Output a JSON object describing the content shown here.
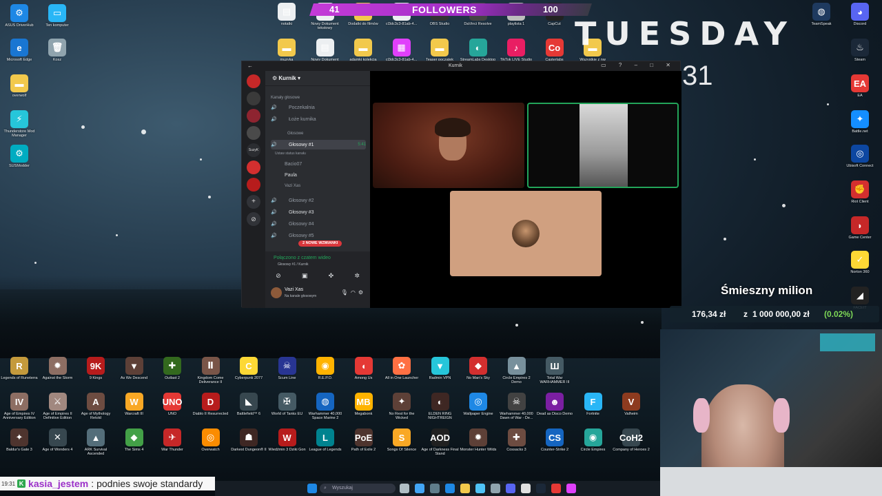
{
  "desktop_top_left": [
    {
      "label": "ASUS DriverHub",
      "color": "#1e88e5",
      "glyph": "⚙"
    },
    {
      "label": "Ten komputer",
      "color": "#29b6f6",
      "glyph": "▭"
    },
    {
      "label": "Microsoft Edge",
      "color": "#1976d2",
      "glyph": "e"
    },
    {
      "label": "Kosz",
      "color": "#90a4ae",
      "glyph": "🗑"
    },
    {
      "label": "overwolf",
      "color": "#f2c94c",
      "glyph": "▬"
    },
    {
      "label": "Thunderstore Mod Manager",
      "color": "#26c6da",
      "glyph": "⚡"
    },
    {
      "label": "SUSModder",
      "color": "#00acc1",
      "glyph": "⚙"
    }
  ],
  "desktop_top_row": [
    {
      "label": "notatki",
      "color": "#eceff1",
      "glyph": "▤"
    },
    {
      "label": "Nowy Dokument tekstowy",
      "color": "#eceff1",
      "glyph": "▤"
    },
    {
      "label": "Dodatki do filmów",
      "color": "#f2c94c",
      "glyph": "▬"
    },
    {
      "label": "cl3dc3c3-81ab-4...",
      "color": "#eceff1",
      "glyph": "▤"
    },
    {
      "label": "OBS Studio",
      "color": "#333",
      "glyph": "◉"
    },
    {
      "label": "DaVinci Resolve",
      "color": "#444",
      "glyph": "◈"
    },
    {
      "label": "playlista 1",
      "color": "#bdbdbd",
      "glyph": "♪"
    },
    {
      "label": "CapCut",
      "color": "#222",
      "glyph": "✂"
    },
    {
      "label": "muzyka",
      "color": "#f2c94c",
      "glyph": "▬"
    },
    {
      "label": "Nowy Dokument tekstowy",
      "color": "#eceff1",
      "glyph": "▤"
    },
    {
      "label": "adamkj kolekcja",
      "color": "#f2c94c",
      "glyph": "▬"
    },
    {
      "label": "cl3dc3c3-81ab-4...",
      "color": "#e040fb",
      "glyph": "▦"
    },
    {
      "label": "Teaser początek",
      "color": "#f2c94c",
      "glyph": "▬"
    },
    {
      "label": "StreamLabs Desktop",
      "color": "#26a69a",
      "glyph": "◐"
    },
    {
      "label": "TikTok LIVE Studio",
      "color": "#e91e63",
      "glyph": "♪"
    },
    {
      "label": "Casterlabs",
      "color": "#e53935",
      "glyph": "Co"
    },
    {
      "label": "Wszystkie z nw",
      "color": "#f2c94c",
      "glyph": "▬"
    }
  ],
  "desktop_right": [
    {
      "label": "TeamSpeak",
      "color": "#1e3a5f",
      "glyph": "◍"
    },
    {
      "label": "Discord",
      "color": "#5865f2",
      "glyph": "◕"
    },
    {
      "label": "Steam",
      "color": "#1b2838",
      "glyph": "♨"
    },
    {
      "label": "EA",
      "color": "#e53935",
      "glyph": "EA"
    },
    {
      "label": "Battle.net",
      "color": "#148eff",
      "glyph": "✦"
    },
    {
      "label": "Ubisoft Connect",
      "color": "#0d47a1",
      "glyph": "◎"
    },
    {
      "label": "Riot Client",
      "color": "#d32f2f",
      "glyph": "✊"
    },
    {
      "label": "Game Center",
      "color": "#c62828",
      "glyph": "◗"
    },
    {
      "label": "Norton 360",
      "color": "#fdd835",
      "glyph": "✓"
    },
    {
      "label": "FACEIT",
      "color": "#222",
      "glyph": "◢"
    }
  ],
  "games_row1": [
    {
      "label": "Legends of Runeterra",
      "color": "#c49a3c",
      "glyph": "R"
    },
    {
      "label": "Against the Storm",
      "color": "#8d6e63",
      "glyph": "✹"
    },
    {
      "label": "9 Kings",
      "color": "#b71c1c",
      "glyph": "9K"
    },
    {
      "label": "As We Descend",
      "color": "#5d4037",
      "glyph": "▼"
    },
    {
      "label": "Outlast 2",
      "color": "#33691e",
      "glyph": "✚"
    },
    {
      "label": "Kingdom Come Deliverance II",
      "color": "#795548",
      "glyph": "Ⅱ"
    },
    {
      "label": "Cyberpunk 2077",
      "color": "#fdd835",
      "glyph": "C"
    },
    {
      "label": "Scum Line",
      "color": "#283593",
      "glyph": "☠"
    },
    {
      "label": "R.E.P.O.",
      "color": "#ffb300",
      "glyph": "◉"
    },
    {
      "label": "Among Us",
      "color": "#e53935",
      "glyph": "◖"
    },
    {
      "label": "All in One Launcher",
      "color": "#ff7043",
      "glyph": "✿"
    },
    {
      "label": "Radmin VPN",
      "color": "#26c6da",
      "glyph": "▼"
    },
    {
      "label": "No Man's Sky",
      "color": "#d32f2f",
      "glyph": "◆"
    },
    {
      "label": "Circle Empires 2 Demo",
      "color": "#78909c",
      "glyph": "▲"
    },
    {
      "label": "Total War WARHAMMER III",
      "color": "#455a64",
      "glyph": "Ш"
    }
  ],
  "games_row2": [
    {
      "label": "Age of Empires IV Anniversary Edition",
      "color": "#8d6e63",
      "glyph": "IV"
    },
    {
      "label": "Age of Empires II Definitive Edition",
      "color": "#a1887f",
      "glyph": "⚔"
    },
    {
      "label": "Age of Mythology Retold",
      "color": "#6d4c41",
      "glyph": "A"
    },
    {
      "label": "Warcraft III",
      "color": "#f9a825",
      "glyph": "W"
    },
    {
      "label": "UNO",
      "color": "#e53935",
      "glyph": "UNO"
    },
    {
      "label": "Diablo II Resurrected",
      "color": "#b71c1c",
      "glyph": "D"
    },
    {
      "label": "Battlefield™ 6",
      "color": "#37474f",
      "glyph": "◣"
    },
    {
      "label": "World of Tanks EU",
      "color": "#455a64",
      "glyph": "✠"
    },
    {
      "label": "Warhammer 40,000 Space Marine 2",
      "color": "#1565c0",
      "glyph": "◍"
    },
    {
      "label": "Megabonk",
      "color": "#ffb300",
      "glyph": "MB"
    },
    {
      "label": "No Rest for the Wicked",
      "color": "#5d4037",
      "glyph": "✦"
    },
    {
      "label": "ELDEN RING NIGHTREIGN",
      "color": "#3e2723",
      "glyph": "◐"
    },
    {
      "label": "Wallpaper Engine",
      "color": "#1e88e5",
      "glyph": "◎"
    },
    {
      "label": "Warhammer 40,000 Dawn of War - De...",
      "color": "#424242",
      "glyph": "☠"
    },
    {
      "label": "Dead as Disco Demo",
      "color": "#7b1fa2",
      "glyph": "☻"
    },
    {
      "label": "Fortnite",
      "color": "#29b6f6",
      "glyph": "F"
    },
    {
      "label": "Valheim",
      "color": "#8d3b1f",
      "glyph": "V"
    }
  ],
  "games_row3": [
    {
      "label": "Baldur's Gate 3",
      "color": "#4e342e",
      "glyph": "✦"
    },
    {
      "label": "Age of Wonders 4",
      "color": "#37474f",
      "glyph": "✕"
    },
    {
      "label": "ARK Survival Ascended",
      "color": "#546e7a",
      "glyph": "▲"
    },
    {
      "label": "The Sims 4",
      "color": "#43a047",
      "glyph": "◆"
    },
    {
      "label": "War Thunder",
      "color": "#c62828",
      "glyph": "✈"
    },
    {
      "label": "Overwatch",
      "color": "#fb8c00",
      "glyph": "◎"
    },
    {
      "label": "Darkest Dungeon® II",
      "color": "#3e2723",
      "glyph": "☗"
    },
    {
      "label": "Wiedźmin 3 Dziki Gon",
      "color": "#b71c1c",
      "glyph": "W"
    },
    {
      "label": "League of Legends",
      "color": "#00838f",
      "glyph": "L"
    },
    {
      "label": "Path of Exile 2",
      "color": "#4e342e",
      "glyph": "PoE"
    },
    {
      "label": "Songs Of Silence",
      "color": "#f9a825",
      "glyph": "S"
    },
    {
      "label": "Age of Darkness Final Stand",
      "color": "#212121",
      "glyph": "AOD"
    },
    {
      "label": "Monster Hunter Wilds",
      "color": "#5d4037",
      "glyph": "✹"
    },
    {
      "label": "Cossacks 3",
      "color": "#6d4c41",
      "glyph": "✚"
    },
    {
      "label": "Counter-Strike 2",
      "color": "#1565c0",
      "glyph": "CS"
    },
    {
      "label": "Circle Empires",
      "color": "#26a69a",
      "glyph": "◉"
    },
    {
      "label": "Company of Heroes 2",
      "color": "#37474f",
      "glyph": "CoH2"
    }
  ],
  "followers": {
    "current": "41",
    "label": "FOLLOWERS",
    "goal": "100",
    "progress": 0.41
  },
  "overlay": {
    "day": "TUESDAY",
    "day_number": "31"
  },
  "discord": {
    "window_title": "Kurnik",
    "server_name": "Kurnik",
    "category_voice": "Kanały głosowe",
    "category_sub": "Głosowe",
    "channels": [
      {
        "name": "Poczekalnia"
      },
      {
        "name": "Łoże kurnika"
      },
      {
        "name": "Głosowy #1",
        "time": "5:41",
        "status": "Ustaw status kanału"
      },
      {
        "name": "Głosowy #2"
      },
      {
        "name": "Głosowy #3"
      },
      {
        "name": "Głosowy #4"
      },
      {
        "name": "Głosowy #5"
      }
    ],
    "voice_users": [
      "Bacio07",
      "Paula",
      "Vazi Xas"
    ],
    "mentions_badge": "2 NOWE WZMIANKI",
    "connected_title": "Połączono z czatem wideo",
    "connected_sub": "Głosowy #1 / Kurnik",
    "user_name": "Vazi Xas",
    "user_status": "Na kanale głosowym"
  },
  "milion": {
    "title": "Śmieszny milion",
    "amount": "176,34 zł",
    "connector": "z",
    "goal": "1 000 000,00 zł",
    "percent": "(0.02%)",
    "percent_color": "#7ed957"
  },
  "chat": {
    "timestamp": "19:31",
    "badge": "K",
    "user": "kasia_jestem",
    "separator": ":",
    "message": "podnies swoje standardy"
  },
  "taskbar": {
    "search_placeholder": "Wyszukaj"
  }
}
